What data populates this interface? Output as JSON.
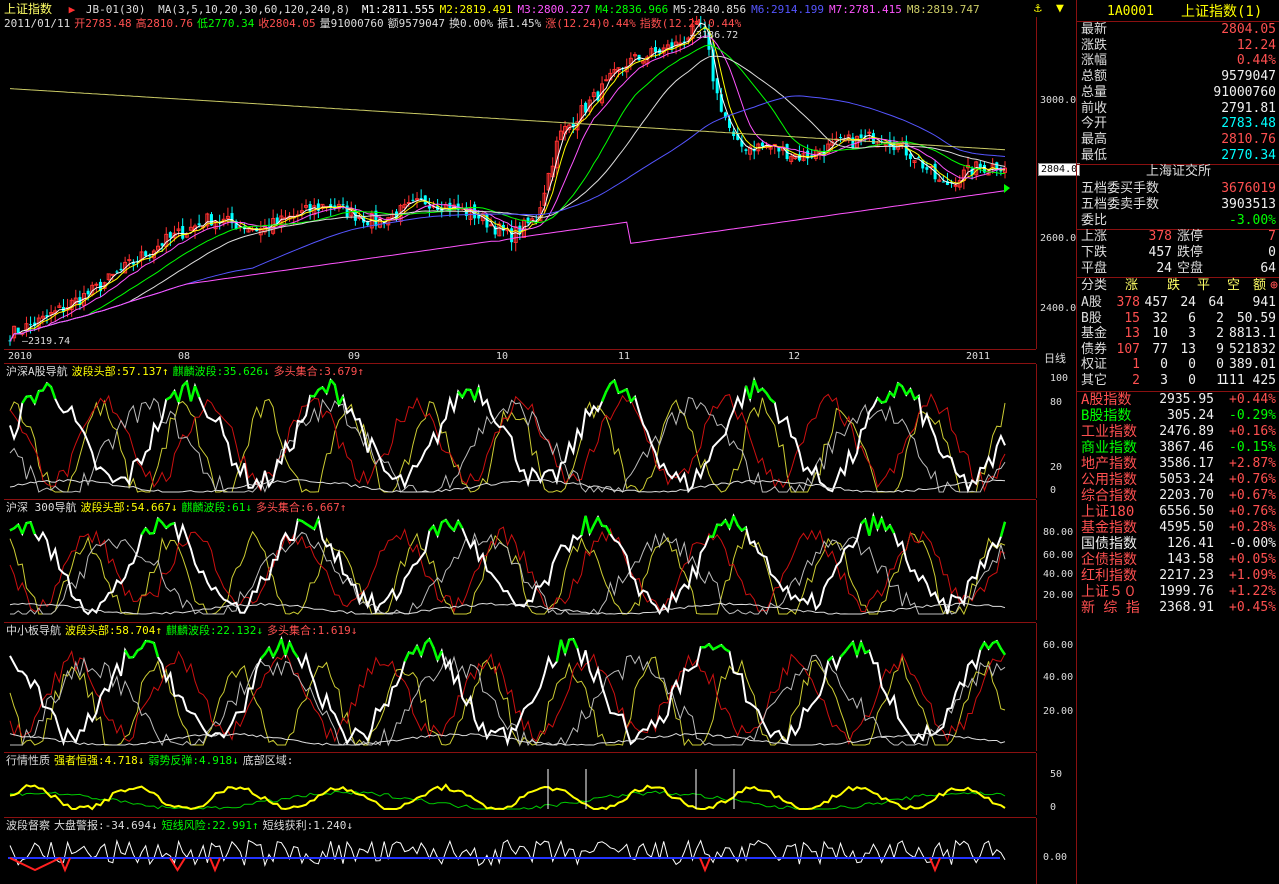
{
  "header": {
    "title": "上证指数",
    "indicator": "JB-01(30)",
    "ma_params": "MA(3,5,10,20,30,60,120,240,8)",
    "ma": [
      {
        "label": "M1:2811.555",
        "color": "#ffffff"
      },
      {
        "label": "M2:2819.491",
        "color": "#ffff00"
      },
      {
        "label": "M3:2800.227",
        "color": "#ff55ff"
      },
      {
        "label": "M4:2836.966",
        "color": "#00ff00"
      },
      {
        "label": "M5:2840.856",
        "color": "#dddddd"
      },
      {
        "label": "M6:2914.199",
        "color": "#5555ff"
      },
      {
        "label": "M7:2781.415",
        "color": "#ff55ff"
      },
      {
        "label": "M8:2819.747",
        "color": "#cccc66"
      }
    ],
    "ohlc_line": [
      {
        "t": "2011/01/11",
        "c": "#dddddd"
      },
      {
        "t": "开2783.48",
        "c": "#ff5050"
      },
      {
        "t": "高2810.76",
        "c": "#ff5050"
      },
      {
        "t": "低2770.34",
        "c": "#00ff00"
      },
      {
        "t": "收2804.05",
        "c": "#ff5050"
      },
      {
        "t": "量91000760",
        "c": "#dddddd"
      },
      {
        "t": "额9579047",
        "c": "#dddddd"
      },
      {
        "t": "换0.00%",
        "c": "#dddddd"
      },
      {
        "t": "振1.45%",
        "c": "#dddddd"
      },
      {
        "t": "涨(12.24)0.44%",
        "c": "#ff5050"
      },
      {
        "t": "指数(12.24)0.44%",
        "c": "#ff5050"
      }
    ]
  },
  "main_chart": {
    "y_ticks": [
      "3000.0",
      "2600.0",
      "2400.0"
    ],
    "x_ticks": [
      "2010",
      "08",
      "09",
      "10",
      "11",
      "12",
      "2011"
    ],
    "period": "日线",
    "high_label": "3186.72",
    "low_label": "2319.74",
    "current_label": "2804.0"
  },
  "panels": [
    {
      "name": "沪深A股导航",
      "items": [
        {
          "t": "波段头部:57.137↑",
          "c": "#ffff00"
        },
        {
          "t": "麒麟波段:35.626↓",
          "c": "#00ff00"
        },
        {
          "t": "多头集合:3.679↑",
          "c": "#ff5050"
        }
      ],
      "ticks": [
        "100",
        "80",
        "20",
        "0"
      ]
    },
    {
      "name": "沪深 300导航",
      "items": [
        {
          "t": "波段头部:54.667↓",
          "c": "#ffff00"
        },
        {
          "t": "麒麟波段:61↓",
          "c": "#00ff00"
        },
        {
          "t": "多头集合:6.667↑",
          "c": "#ff5050"
        }
      ],
      "ticks": [
        "80.00",
        "60.00",
        "40.00",
        "20.00"
      ]
    },
    {
      "name": "中小板导航",
      "items": [
        {
          "t": "波段头部:58.704↑",
          "c": "#ffff00"
        },
        {
          "t": "麒麟波段:22.132↓",
          "c": "#00ff00"
        },
        {
          "t": "多头集合:1.619↓",
          "c": "#ff5050"
        }
      ],
      "ticks": [
        "60.00",
        "40.00",
        "20.00"
      ]
    },
    {
      "name": "行情性质",
      "items": [
        {
          "t": "强者恒强:4.718↓",
          "c": "#ffff00"
        },
        {
          "t": "弱势反弹:4.918↓",
          "c": "#00ff00"
        },
        {
          "t": "底部区域:",
          "c": "#dddddd"
        }
      ],
      "ticks": [
        "50",
        "0"
      ]
    },
    {
      "name": "波段督察",
      "items": [
        {
          "t": "大盘警报:-34.694↓",
          "c": "#dddddd"
        },
        {
          "t": "短线风险:22.991↑",
          "c": "#00ff00"
        },
        {
          "t": "短线获利:1.240↓",
          "c": "#dddddd"
        }
      ],
      "ticks": [
        "0.00"
      ]
    }
  ],
  "quote": {
    "code": "1A0001",
    "name": "上证指数(1)",
    "rows": [
      {
        "l": "最新",
        "v": "2804.05",
        "c": "#ff5050"
      },
      {
        "l": "涨跌",
        "v": "12.24",
        "c": "#ff5050"
      },
      {
        "l": "涨幅",
        "v": "0.44%",
        "c": "#ff5050"
      },
      {
        "l": "总额",
        "v": "9579047",
        "c": "#f0f0f0"
      },
      {
        "l": "总量",
        "v": "91000760",
        "c": "#f0f0f0"
      },
      {
        "l": "前收",
        "v": "2791.81",
        "c": "#f0f0f0"
      },
      {
        "l": "今开",
        "v": "2783.48",
        "c": "#00ffff"
      },
      {
        "l": "最高",
        "v": "2810.76",
        "c": "#ff5050"
      },
      {
        "l": "最低",
        "v": "2770.34",
        "c": "#00ffff"
      }
    ],
    "exchange": "上海证交所",
    "orders": [
      {
        "l": "五档委买手数",
        "v": "3676019",
        "c": "#ff5050"
      },
      {
        "l": "五档委卖手数",
        "v": "3903513",
        "c": "#f0f0f0"
      },
      {
        "l": "委比",
        "v": "-3.00%",
        "c": "#00ff00"
      }
    ],
    "breadth": [
      {
        "l1": "上涨",
        "v1": "378",
        "c1": "#ff5050",
        "l2": "涨停",
        "v2": "7",
        "c2": "#ff5050"
      },
      {
        "l1": "下跌",
        "v1": "457",
        "c1": "#f0f0f0",
        "l2": "跌停",
        "v2": "0",
        "c2": "#f0f0f0"
      },
      {
        "l1": "平盘",
        "v1": "24",
        "c1": "#f0f0f0",
        "l2": "空盘",
        "v2": "64",
        "c2": "#f0f0f0"
      }
    ],
    "class_header": [
      "分类",
      "涨",
      "跌",
      "平",
      "空",
      "额"
    ],
    "classes": [
      {
        "n": "A股",
        "u": "378",
        "d": "457",
        "f": "24",
        "e": "64",
        "a": "941"
      },
      {
        "n": "B股",
        "u": "15",
        "d": "32",
        "f": "6",
        "e": "2",
        "a": "50.59"
      },
      {
        "n": "基金",
        "u": "13",
        "d": "10",
        "f": "3",
        "e": "2",
        "a": "8813.1"
      },
      {
        "n": "债券",
        "u": "107",
        "d": "77",
        "f": "13",
        "e": "9",
        "a": "521832"
      },
      {
        "n": "权证",
        "u": "1",
        "d": "0",
        "f": "0",
        "e": "0",
        "a": "389.01"
      },
      {
        "n": "其它",
        "u": "2",
        "d": "3",
        "f": "0",
        "e": "1",
        "a": "111 425"
      }
    ],
    "indices": [
      {
        "n": "A股指数",
        "v": "2935.95",
        "p": "+0.44%",
        "c": "#ff5050"
      },
      {
        "n": "B股指数",
        "v": "305.24",
        "p": "-0.29%",
        "c": "#00ff00"
      },
      {
        "n": "工业指数",
        "v": "2476.89",
        "p": "+0.16%",
        "c": "#ff5050"
      },
      {
        "n": "商业指数",
        "v": "3867.46",
        "p": "-0.15%",
        "c": "#00ff00"
      },
      {
        "n": "地产指数",
        "v": "3586.17",
        "p": "+2.87%",
        "c": "#ff5050"
      },
      {
        "n": "公用指数",
        "v": "5053.24",
        "p": "+0.76%",
        "c": "#ff5050"
      },
      {
        "n": "综合指数",
        "v": "2203.70",
        "p": "+0.67%",
        "c": "#ff5050"
      },
      {
        "n": "上证180",
        "v": "6556.50",
        "p": "+0.76%",
        "c": "#ff5050"
      },
      {
        "n": "基金指数",
        "v": "4595.50",
        "p": "+0.28%",
        "c": "#ff5050"
      },
      {
        "n": "国债指数",
        "v": "126.41",
        "p": "-0.00%",
        "c": "#f0f0f0"
      },
      {
        "n": "企债指数",
        "v": "143.58",
        "p": "+0.05%",
        "c": "#ff5050"
      },
      {
        "n": "红利指数",
        "v": "2217.23",
        "p": "+1.09%",
        "c": "#ff5050"
      },
      {
        "n": "上证５０",
        "v": "1999.76",
        "p": "+1.22%",
        "c": "#ff5050"
      },
      {
        "n": "新 综 指",
        "v": "2368.91",
        "p": "+0.45%",
        "c": "#ff5050"
      }
    ]
  }
}
